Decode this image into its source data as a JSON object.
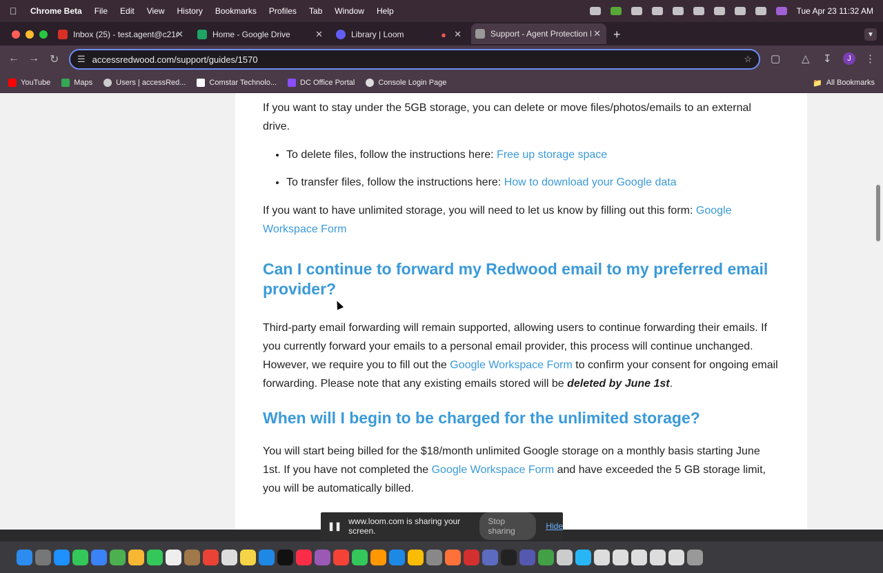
{
  "menubar": {
    "app_name": "Chrome Beta",
    "items": [
      "File",
      "Edit",
      "View",
      "History",
      "Bookmarks",
      "Profiles",
      "Tab",
      "Window",
      "Help"
    ],
    "clock": "Tue Apr 23  11:32 AM"
  },
  "tabs": [
    {
      "title": "Inbox (25) - test.agent@c21r",
      "icon": "gmail-icon",
      "color": "#d93025"
    },
    {
      "title": "Home - Google Drive",
      "icon": "drive-icon",
      "color": "#1fa463"
    },
    {
      "title": "Library | Loom",
      "icon": "loom-icon",
      "color": "#625df5"
    },
    {
      "title": "Support - Agent Protection Pl",
      "icon": "redwood-icon",
      "color": "#999999"
    }
  ],
  "omnibox": {
    "url": "accessredwood.com/support/guides/1570"
  },
  "avatar_initial": "J",
  "bookmarks": [
    {
      "label": "YouTube",
      "color": "#ff0000"
    },
    {
      "label": "Maps",
      "color": "#34a853"
    },
    {
      "label": "Users | accessRed...",
      "color": "#cccccc"
    },
    {
      "label": "Comstar Technolo...",
      "color": "#ffffff"
    },
    {
      "label": "DC Office Portal",
      "color": "#8a4dff"
    },
    {
      "label": "Console Login Page",
      "color": "#dddddd"
    }
  ],
  "all_bookmarks": "All Bookmarks",
  "content": {
    "p1": "If you want to stay under the 5GB storage, you can delete or move files/photos/emails to an external drive.",
    "li1_text": "To delete files, follow the instructions here: ",
    "li1_link": "Free up storage space",
    "li2_text": "To transfer files, follow the instructions here: ",
    "li2_link": "How to download your Google data",
    "p2_text": "If you want to have unlimited storage, you will need to let us know by filling out this form: ",
    "p2_link": "Google Workspace Form",
    "h2_1": "Can I continue to forward my Redwood email to my preferred email provider?",
    "p3_a": "Third-party email forwarding will remain supported, allowing users to continue forwarding their emails. If you currently forward your emails to a personal email provider, this process will continue unchanged. However, we require you to fill out the ",
    "p3_link": "Google Workspace Form",
    "p3_b": " to confirm your consent for ongoing email forwarding. Please note that any existing emails stored will be ",
    "p3_em": "deleted by June 1st",
    "p3_c": ".",
    "h2_2": "When will I begin to be charged for the unlimited storage?",
    "p4_a": "You will start being billed for the $18/month unlimited Google storage on a monthly basis starting June 1st. If you have not completed the ",
    "p4_link": "Google Workspace Form",
    "p4_b": " and have exceeded the 5 GB storage limit, you will be automatically billed."
  },
  "share_bar": {
    "message": "www.loom.com is sharing your screen.",
    "stop": "Stop sharing",
    "hide": "Hide"
  }
}
